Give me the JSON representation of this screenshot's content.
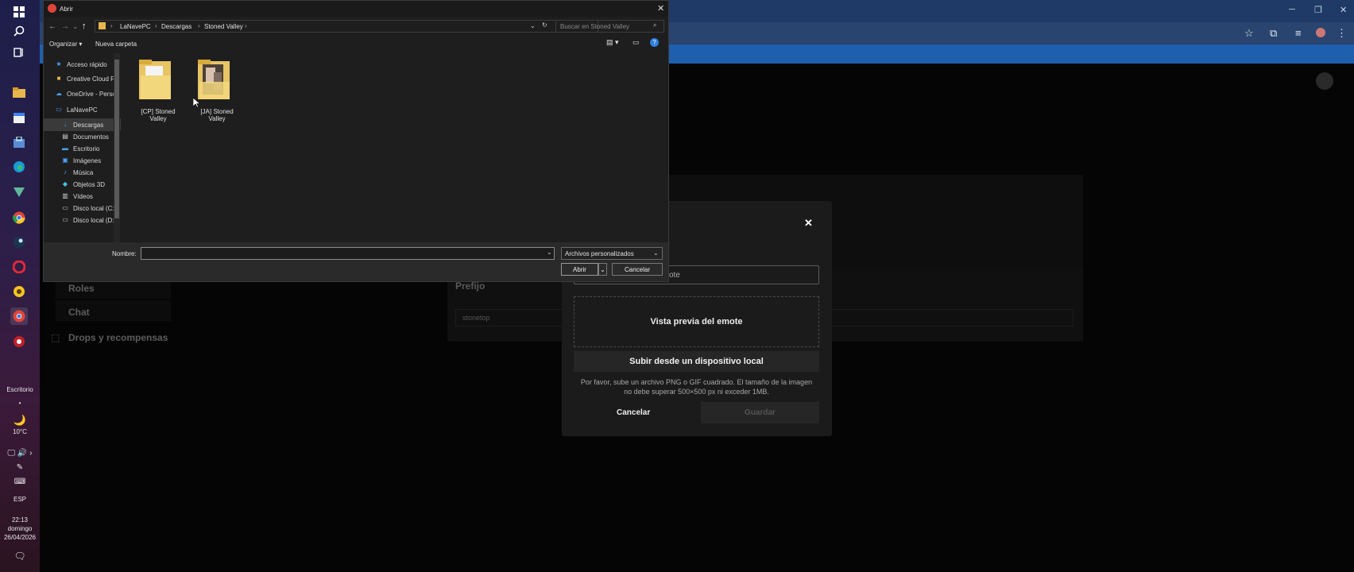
{
  "taskbar": {
    "desktop_label": "Escritorio",
    "weather_temp": "10°C",
    "language": "ESP",
    "time": "22:13",
    "day": "domingo",
    "date": "26/04/2026",
    "dot": "•"
  },
  "background_page": {
    "nav_items": [
      "Roles",
      "Chat",
      "Drops y recompensas"
    ],
    "prefix_label": "Prefijo",
    "prefix_value": "stonetop"
  },
  "emote_modal": {
    "close_icon": "✕",
    "name_value_partial": "ote",
    "preview_label": "Vista previa del emote",
    "upload_button": "Subir desde un dispositivo local",
    "help_text": "Por favor, sube un archivo PNG o GIF cuadrado. El tamaño de la imagen no debe superar 500×500 px ni exceder 1MB.",
    "cancel_button": "Cancelar",
    "save_button": "Guardar"
  },
  "file_dialog": {
    "title": "Abrir",
    "breadcrumb": [
      "LaNavePC",
      "Descargas",
      "Stoned Valley"
    ],
    "search_placeholder": "Buscar en Stoned Valley",
    "organize_label": "Organizar ▾",
    "new_folder_label": "Nueva carpeta",
    "sidebar_items": [
      {
        "label": "Acceso rápido",
        "icon": "star-icon",
        "glyph": "★",
        "color": "#4aa3ff"
      },
      {
        "label": "Creative Cloud Fil",
        "icon": "folder-icon",
        "glyph": "■",
        "color": "#e8b64c"
      },
      {
        "label": "OneDrive - Person",
        "icon": "cloud-icon",
        "glyph": "☁",
        "color": "#4aa3ff"
      },
      {
        "label": "LaNavePC",
        "icon": "computer-icon",
        "glyph": "▭",
        "color": "#4aa3ff"
      },
      {
        "label": "Descargas",
        "icon": "download-icon",
        "glyph": "↓",
        "color": "#4aa3ff"
      },
      {
        "label": "Documentos",
        "icon": "documents-icon",
        "glyph": "▤",
        "color": "#cfcfcf"
      },
      {
        "label": "Escritorio",
        "icon": "desktop-icon",
        "glyph": "▬",
        "color": "#4aa3ff"
      },
      {
        "label": "Imágenes",
        "icon": "pictures-icon",
        "glyph": "▣",
        "color": "#4aa3ff"
      },
      {
        "label": "Música",
        "icon": "music-icon",
        "glyph": "♪",
        "color": "#4aa3ff"
      },
      {
        "label": "Objetos 3D",
        "icon": "cube-icon",
        "glyph": "◆",
        "color": "#4ac3e0"
      },
      {
        "label": "Vídeos",
        "icon": "video-icon",
        "glyph": "▥",
        "color": "#cfcfcf"
      },
      {
        "label": "Disco local (C:)",
        "icon": "drive-icon",
        "glyph": "▭",
        "color": "#cfcfcf"
      },
      {
        "label": "Disco local (D:)",
        "icon": "drive-icon",
        "glyph": "▭",
        "color": "#cfcfcf"
      }
    ],
    "files": [
      {
        "label_line1": "[CP] Stoned",
        "label_line2": "Valley"
      },
      {
        "label_line1": "[JA] Stoned",
        "label_line2": "Valley"
      }
    ],
    "filename_label": "Nombre:",
    "filename_value": "",
    "filter_value": "Archivos personalizados",
    "open_button": "Abrir",
    "cancel_button": "Cancelar",
    "close_glyph": "✕"
  },
  "colors": {
    "chrome_bar": "#29446f",
    "accent_blue": "#1e5fae",
    "dialog_bg": "#1e1e1e",
    "modal_bg": "#1b1b1b"
  }
}
